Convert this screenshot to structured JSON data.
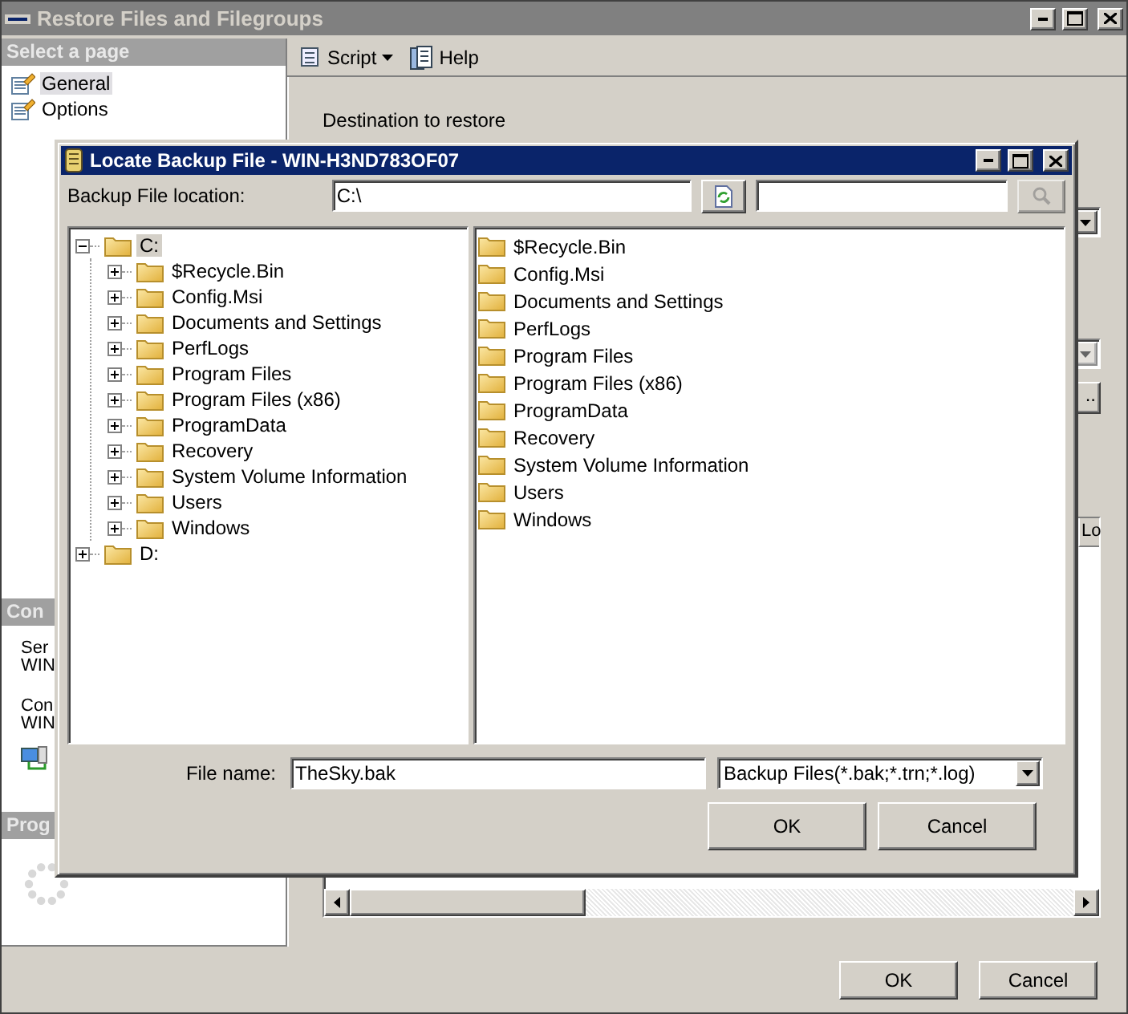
{
  "window": {
    "title": "Restore Files and Filegroups"
  },
  "sidebar": {
    "header": "Select a page",
    "pages": [
      {
        "label": "General",
        "selected": true
      },
      {
        "label": "Options",
        "selected": false
      }
    ],
    "connection_header": "Con",
    "connection_lines": [
      "Ser",
      "WIN",
      "Con",
      "WIN"
    ],
    "progress_header": "Prog"
  },
  "toolbar": [
    {
      "label": "Script",
      "kind": "dropdown"
    },
    {
      "label": "Help",
      "kind": "button"
    }
  ],
  "content": {
    "section": "Destination to restore",
    "browse_button": "..",
    "column_1": "Lo"
  },
  "buttons": [
    "OK",
    "Cancel"
  ],
  "dialog": {
    "title": "Locate Backup File - WIN-H3ND783OF07",
    "location_label": "Backup File location:",
    "location": "C:\\",
    "tree": [
      {
        "label": "C:",
        "expanded": true,
        "selected": true,
        "children": [
          {
            "label": "$Recycle.Bin",
            "expanded": false,
            "selected": false
          },
          {
            "label": "Config.Msi",
            "expanded": false,
            "selected": false
          },
          {
            "label": "Documents and Settings",
            "expanded": false,
            "selected": false
          },
          {
            "label": "PerfLogs",
            "expanded": false,
            "selected": false
          },
          {
            "label": "Program Files",
            "expanded": false,
            "selected": false
          },
          {
            "label": "Program Files (x86)",
            "expanded": false,
            "selected": false
          },
          {
            "label": "ProgramData",
            "expanded": false,
            "selected": false
          },
          {
            "label": "Recovery",
            "expanded": false,
            "selected": false
          },
          {
            "label": "System Volume Information",
            "expanded": false,
            "selected": false
          },
          {
            "label": "Users",
            "expanded": false,
            "selected": false
          },
          {
            "label": "Windows",
            "expanded": false,
            "selected": false
          }
        ]
      },
      {
        "label": "D:",
        "expanded": false,
        "selected": false
      }
    ],
    "files": [
      "$Recycle.Bin",
      "Config.Msi",
      "Documents and Settings",
      "PerfLogs",
      "Program Files",
      "Program Files (x86)",
      "ProgramData",
      "Recovery",
      "System Volume Information",
      "Users",
      "Windows"
    ],
    "file_name_label": "File name:",
    "file_name": "TheSky.bak",
    "file_type": "Backup Files(*.bak;*.trn;*.log)",
    "buttons": [
      "OK",
      "Cancel"
    ]
  }
}
